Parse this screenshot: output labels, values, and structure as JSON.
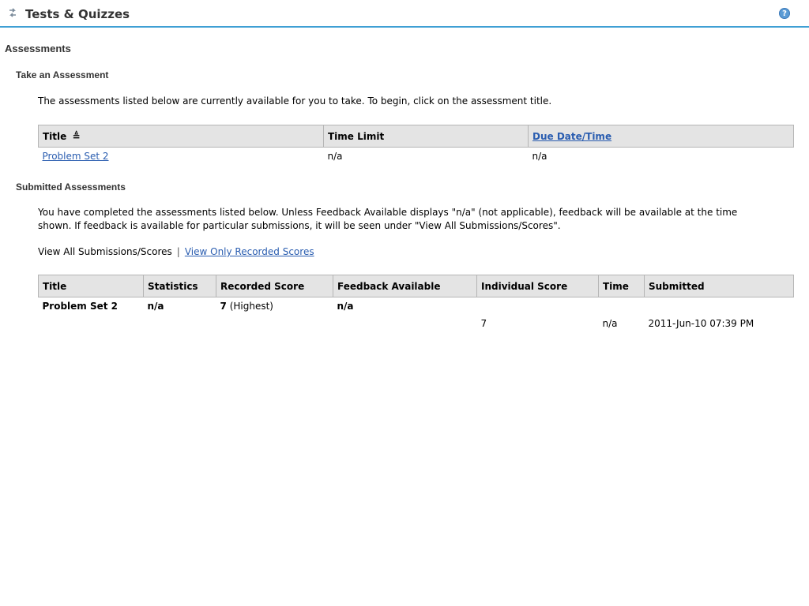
{
  "tool": {
    "title": "Tests & Quizzes",
    "icon": "refresh-arrows-icon",
    "help_icon": "help-icon"
  },
  "headings": {
    "assessments": "Assessments",
    "take": "Take an Assessment",
    "submitted": "Submitted Assessments"
  },
  "take_instructions": "The assessments listed below are currently available for you to take. To begin, click on the assessment title.",
  "take_table": {
    "headers": {
      "title": "Title",
      "time_limit": "Time Limit",
      "due": "Due Date/Time"
    },
    "sort_glyph": "≜",
    "rows": [
      {
        "title": "Problem Set 2",
        "time_limit": "n/a",
        "due": "n/a"
      }
    ]
  },
  "submitted_instructions": {
    "line1": "You have completed the assessments listed below. Unless Feedback Available displays \"n/a\" (not applicable), feedback will be available at the time",
    "line2": "shown. If feedback is available for particular submissions, it will be seen under \"View All Submissions/Scores\"."
  },
  "view_links": {
    "all": "View All Submissions/Scores",
    "separator": "|",
    "recorded": "View Only Recorded Scores"
  },
  "submitted_table": {
    "headers": {
      "title": "Title",
      "statistics": "Statistics",
      "recorded_score": "Recorded Score",
      "feedback": "Feedback Available",
      "individual_score": "Individual Score",
      "time": "Time",
      "submitted": "Submitted"
    },
    "rows": [
      {
        "title": "Problem Set 2",
        "statistics": "n/a",
        "recorded_score_value": "7",
        "recorded_score_note": "(Highest)",
        "feedback": "n/a"
      }
    ],
    "sub_rows": [
      {
        "individual_score": "7",
        "time": "n/a",
        "submitted": "2011-Jun-10 07:39 PM"
      }
    ]
  },
  "colors": {
    "accent": "#3f9fd4",
    "link": "#2a5db0",
    "header_bg": "#e4e4e4"
  }
}
